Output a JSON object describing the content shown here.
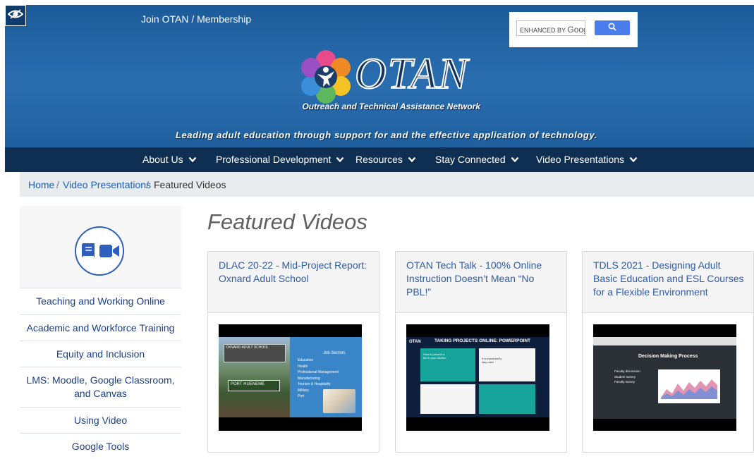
{
  "header": {
    "join_label": "Join OTAN / Membership",
    "search_placeholder_brand": "ENHANCED BY",
    "search_placeholder_google": "Goog",
    "logo_word": "OTAN",
    "logo_subtitle": "Outreach and Technical Assistance Network",
    "tagline": "Leading adult education through support for and the effective application of technology."
  },
  "nav": {
    "items": [
      {
        "label": "About Us"
      },
      {
        "label": "Professional Development"
      },
      {
        "label": "Resources"
      },
      {
        "label": "Stay Connected"
      },
      {
        "label": "Video Presentations"
      }
    ]
  },
  "breadcrumb": {
    "home": "Home",
    "section": "Video Presentations",
    "separator": "/",
    "current": "Featured Videos"
  },
  "sidebar": {
    "items": [
      {
        "label": "Teaching and Working Online"
      },
      {
        "label": "Academic and Workforce Training"
      },
      {
        "label": "Equity and Inclusion"
      },
      {
        "label": "LMS: Moodle, Google Classroom, and Canvas"
      },
      {
        "label": "Using Video"
      },
      {
        "label": "Google Tools"
      }
    ]
  },
  "main": {
    "title": "Featured Videos",
    "cards": [
      {
        "title": "DLAC 20-22 - Mid-Project Report: Oxnard Adult School",
        "thumb": {
          "sign_top": "OXNARD ADULT SCHOOL",
          "sign_bottom": "PORT HUENEME",
          "heading": "Job Sectors",
          "list": [
            "Education",
            "Health",
            "Professional Management",
            "Manufacturing",
            "Tourism & Hospitality",
            "Military",
            "Port"
          ]
        }
      },
      {
        "title": "OTAN Tech Talk - 100% Online Instruction Doesn’t Mean “No PBL!”",
        "thumb": {
          "brand": "OTAN",
          "banner": "TAKING PROJECTS ONLINE: POWERPOINT",
          "slide1": "How to present a fire in your kitchen",
          "slide2": "It is important to stay calm"
        }
      },
      {
        "title": "TDLS 2021 - Designing Adult Basic Education and ESL Courses for a Flexible Environment",
        "thumb": {
          "heading": "Decision Making Process",
          "bullets": [
            "Faculty discussion",
            "Student survey",
            "Faculty survey"
          ]
        }
      }
    ]
  },
  "colors": {
    "header_blue": "#1c5b99",
    "nav_navy": "#0e2e52",
    "link_blue": "#1d5fb4",
    "search_button": "#4a7eef"
  },
  "icons": {
    "accessibility": "eye-icon",
    "search": "search-icon",
    "nav_dropdown": "chevron-down-icon",
    "sidebar": [
      "book-icon",
      "video-camera-icon"
    ]
  }
}
